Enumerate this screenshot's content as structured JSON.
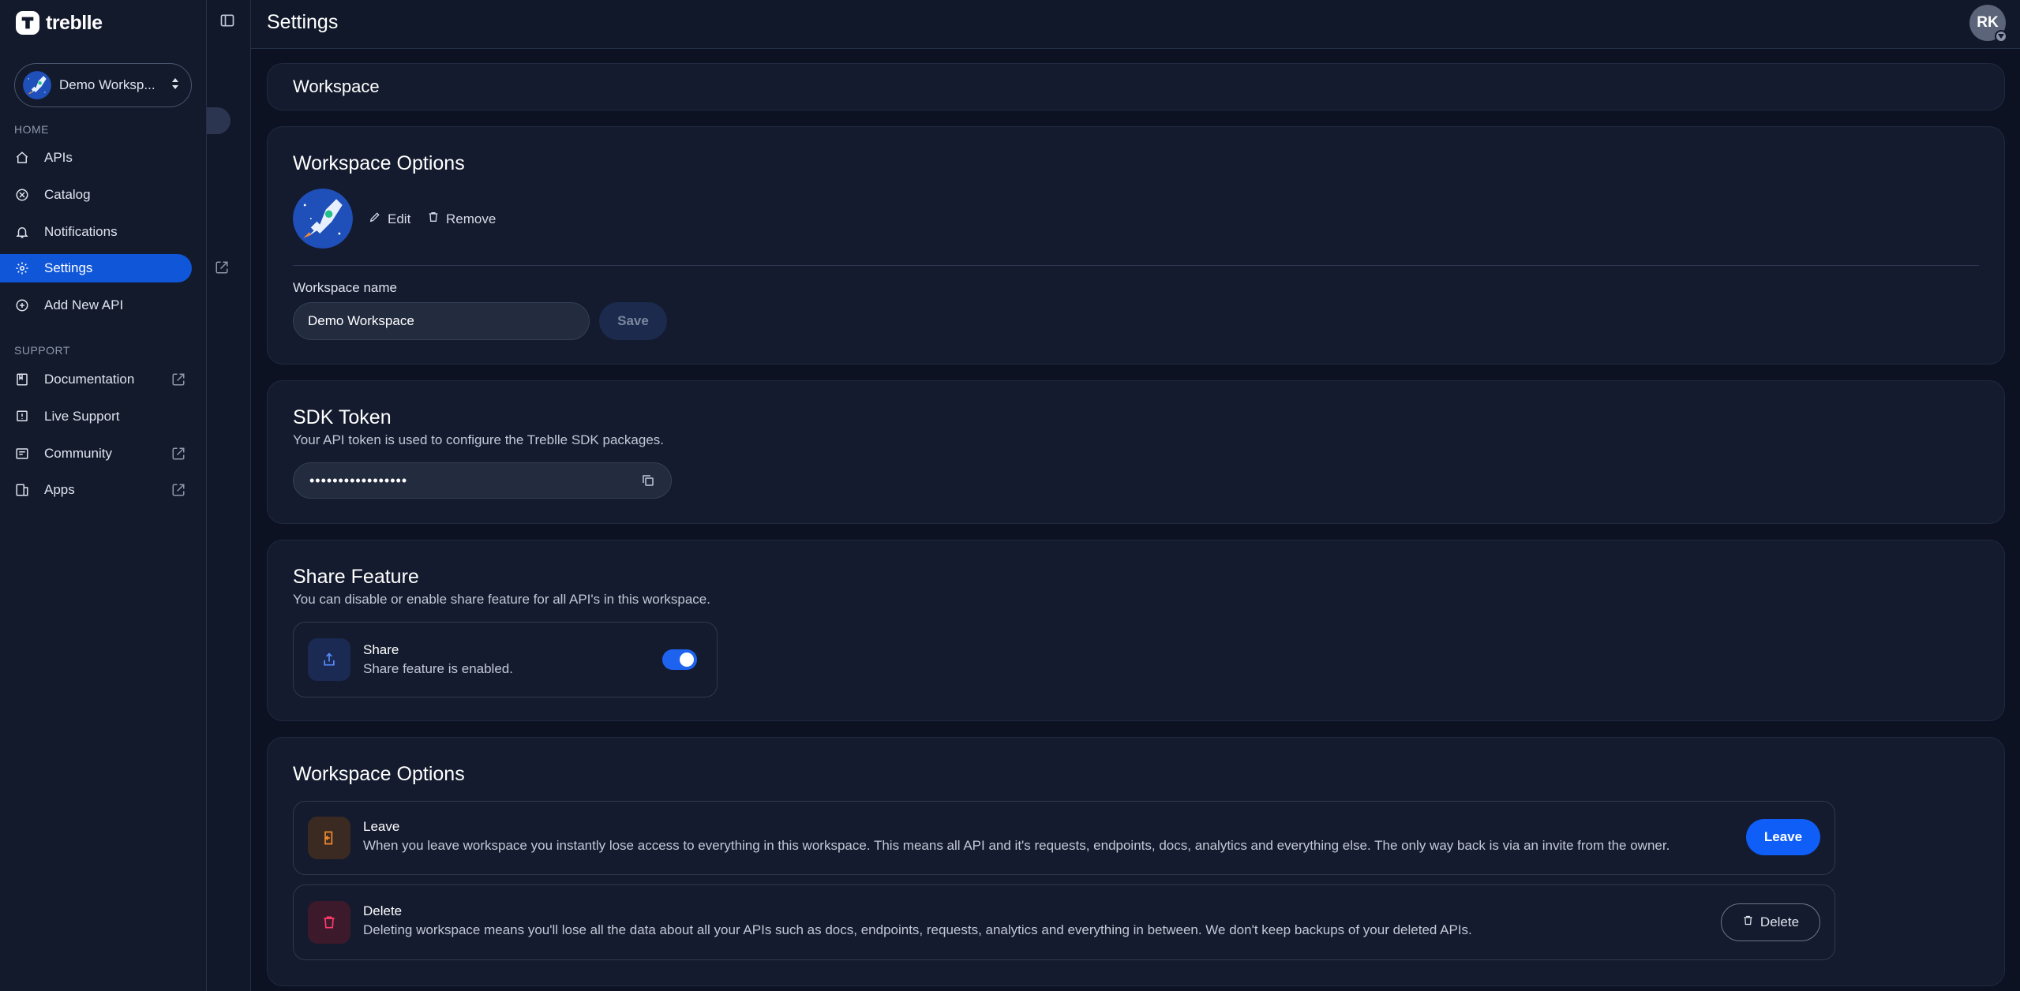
{
  "brand": {
    "name": "treblle"
  },
  "workspace_selector": {
    "name": "Demo Worksp..."
  },
  "sidebar": {
    "home_label": "HOME",
    "support_label": "SUPPORT",
    "home_items": [
      {
        "label": "APIs",
        "icon": "home-icon"
      },
      {
        "label": "Catalog",
        "icon": "catalog-icon"
      },
      {
        "label": "Notifications",
        "icon": "bell-icon"
      },
      {
        "label": "Settings",
        "icon": "gear-icon",
        "active": true
      },
      {
        "label": "Add New API",
        "icon": "plus-circle-icon"
      }
    ],
    "support_items": [
      {
        "label": "Documentation",
        "icon": "book-icon",
        "external": true
      },
      {
        "label": "Live Support",
        "icon": "chat-icon",
        "external": false
      },
      {
        "label": "Community",
        "icon": "community-icon",
        "external": true
      },
      {
        "label": "Apps",
        "icon": "apps-icon",
        "external": true
      }
    ]
  },
  "header": {
    "title": "Settings",
    "user_initials": "RK"
  },
  "workspace_card": {
    "title": "Workspace"
  },
  "workspace_options": {
    "title": "Workspace Options",
    "edit_label": "Edit",
    "remove_label": "Remove",
    "name_label": "Workspace name",
    "name_value": "Demo Workspace",
    "save_label": "Save"
  },
  "sdk_token": {
    "title": "SDK Token",
    "description": "Your API token is used to configure the Treblle SDK packages.",
    "masked_value": "•••••••••••••••••"
  },
  "share_feature": {
    "title": "Share Feature",
    "description": "You can disable or enable share feature for all API's in this workspace.",
    "item_title": "Share",
    "item_desc": "Share feature is enabled.",
    "enabled": true
  },
  "danger_options": {
    "title": "Workspace Options",
    "leave": {
      "title": "Leave",
      "description": "When you leave workspace you instantly lose access to everything in this workspace. This means all API and it's requests, endpoints, docs, analytics and everything else. The only way back is via an invite from the owner.",
      "button": "Leave"
    },
    "delete": {
      "title": "Delete",
      "description": "Deleting workspace means you'll lose all the data about all your APIs such as docs, endpoints, requests, analytics and everything in between. We don't keep backups of your deleted APIs.",
      "button": "Delete"
    }
  },
  "colors": {
    "accent": "#0f5ef7",
    "active_nav": "#0f56d9",
    "background": "#0c1222",
    "card": "#141b2e",
    "leave_tile": "#3a2a22",
    "delete_tile": "#3c1a2b"
  }
}
